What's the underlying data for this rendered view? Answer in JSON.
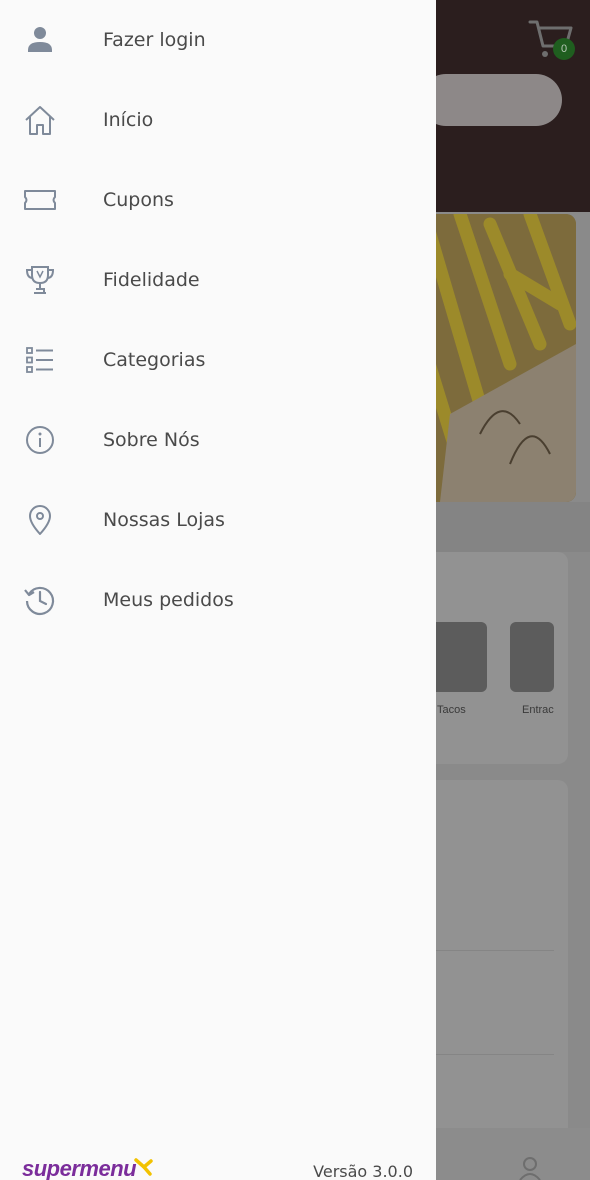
{
  "drawer": {
    "items": [
      {
        "label": "Fazer login",
        "icon": "person-icon"
      },
      {
        "label": "Início",
        "icon": "home-icon"
      },
      {
        "label": "Cupons",
        "icon": "ticket-icon"
      },
      {
        "label": "Fidelidade",
        "icon": "trophy-icon"
      },
      {
        "label": "Categorias",
        "icon": "list-icon"
      },
      {
        "label": "Sobre Nós",
        "icon": "info-icon"
      },
      {
        "label": "Nossas Lojas",
        "icon": "location-pin-icon"
      },
      {
        "label": "Meus pedidos",
        "icon": "history-icon"
      }
    ],
    "footer": {
      "brand": "supermenu",
      "version": "Versão 3.0.0"
    }
  },
  "background": {
    "cart_count": "0",
    "categories": [
      "Tacos",
      "Entrac"
    ]
  },
  "colors": {
    "icon": "#7f8a9a",
    "label": "#4a4a4a",
    "brand": "#7b2d9b",
    "brand_accent": "#f2c200",
    "header_bg": "#2b1e1e",
    "badge": "#1f5e1f"
  }
}
